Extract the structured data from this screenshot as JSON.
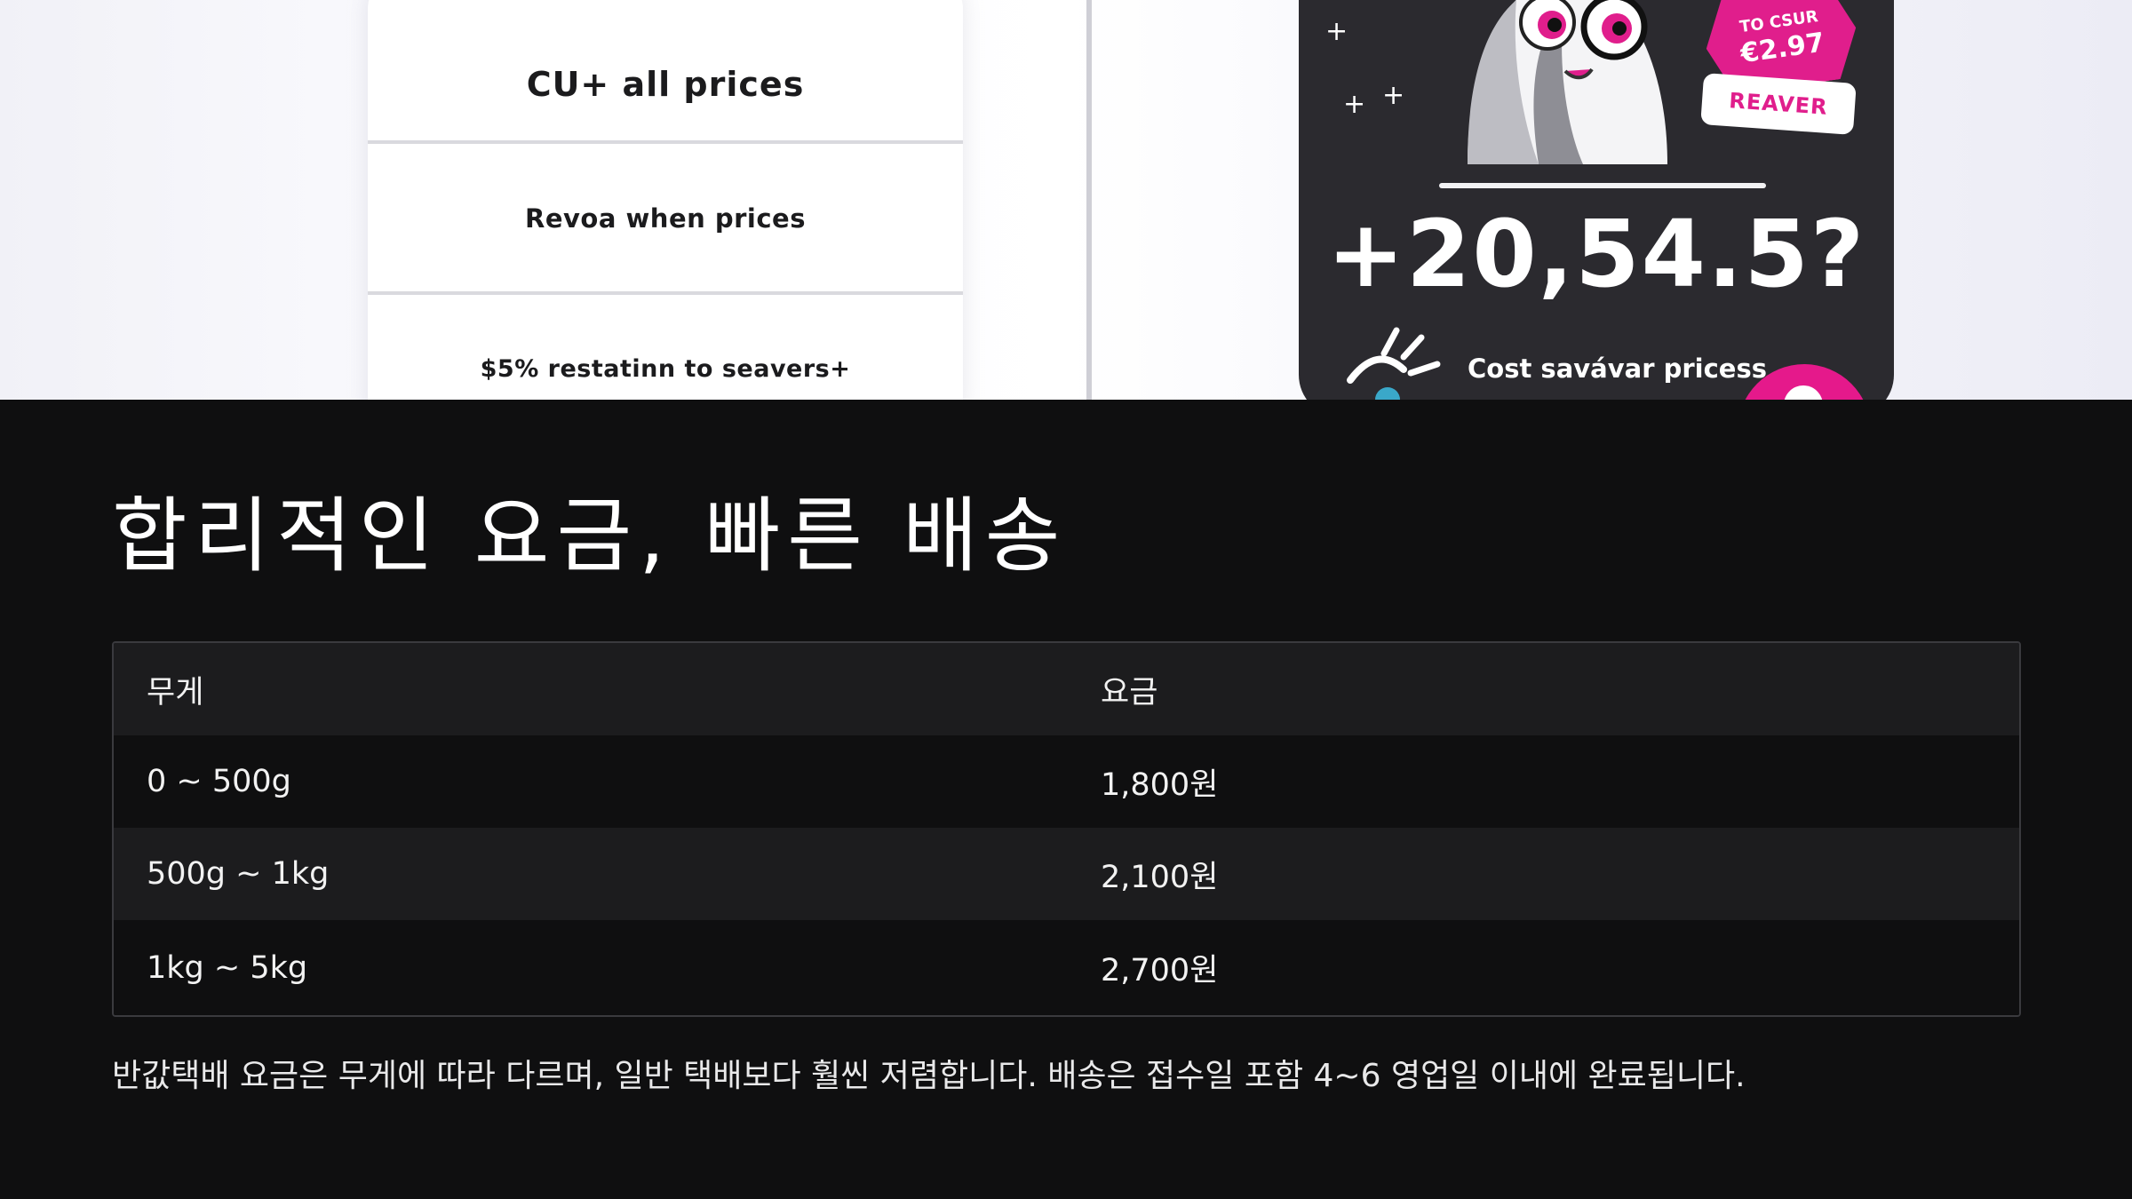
{
  "hero": {
    "price_card": {
      "row1": "CU+ all prices",
      "row2": "Revoa when prices",
      "row3": "$5% restatinn to seavers+"
    },
    "promo_card": {
      "hex_top": "TO CSUR",
      "hex_price": "€2.97",
      "tag": "REAVER",
      "big_figure": "+20,54.5?",
      "caption": "Cost savávar pricess"
    }
  },
  "section": {
    "title": "합리적인 요금, 빠른 배송",
    "table": {
      "headers": [
        "무게",
        "요금"
      ],
      "rows": [
        [
          "0 ~ 500g",
          "1,800원"
        ],
        [
          "500g ~ 1kg",
          "2,100원"
        ],
        [
          "1kg ~ 5kg",
          "2,700원"
        ]
      ]
    },
    "footnote": "반값택배 요금은 무게에 따라 다르며, 일반 택배보다 훨씬 저렴합니다. 배송은 접수일 포함 4~6 영업일 이내에 완료됩니다."
  },
  "colors": {
    "background": "#0f0f10",
    "table_stripe": "#1c1c1e",
    "accent_pink": "#e01e8c",
    "promo_card": "#2b2a2f"
  },
  "icons": [
    "sparkle-icon",
    "burst-icon"
  ]
}
